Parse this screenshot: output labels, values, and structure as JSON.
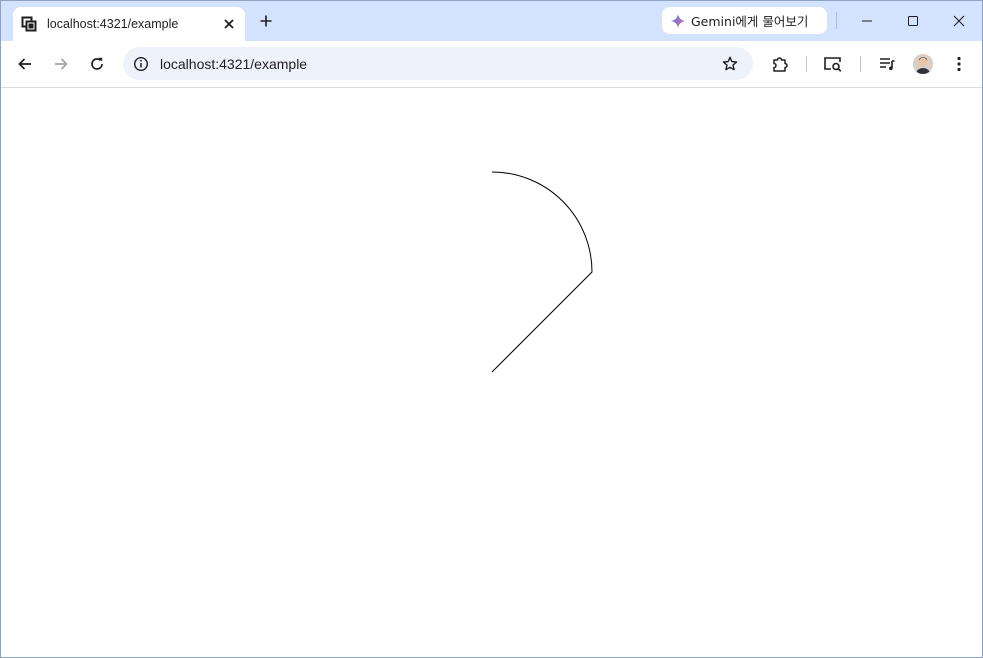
{
  "browser": {
    "tab": {
      "title": "localhost:4321/example",
      "favicon": "site-favicon-icon",
      "close_icon": "close-icon"
    },
    "new_tab_icon": "plus-icon",
    "gemini_button": {
      "label": "Gemini에게 물어보기",
      "icon": "gemini-sparkle-icon"
    },
    "window_controls": [
      "minimize-icon",
      "maximize-icon",
      "close-icon"
    ],
    "toolbar": {
      "back_icon": "back-arrow-icon",
      "forward_icon": "forward-arrow-icon",
      "reload_icon": "reload-icon",
      "site_info_icon": "info-icon",
      "url": "localhost:4321/example",
      "bookmark_icon": "star-icon",
      "extensions_icon": "puzzle-icon",
      "cast_icon": "screen-search-icon",
      "media_icon": "media-queue-icon",
      "menu_icon": "more-vert-icon"
    }
  },
  "page": {
    "drawing": "arc-path",
    "stroke_color": "#000000"
  },
  "colors": {
    "tabstrip": "#d3e3fd",
    "omnibox": "#eef2fa",
    "text": "#1f1f1f"
  }
}
